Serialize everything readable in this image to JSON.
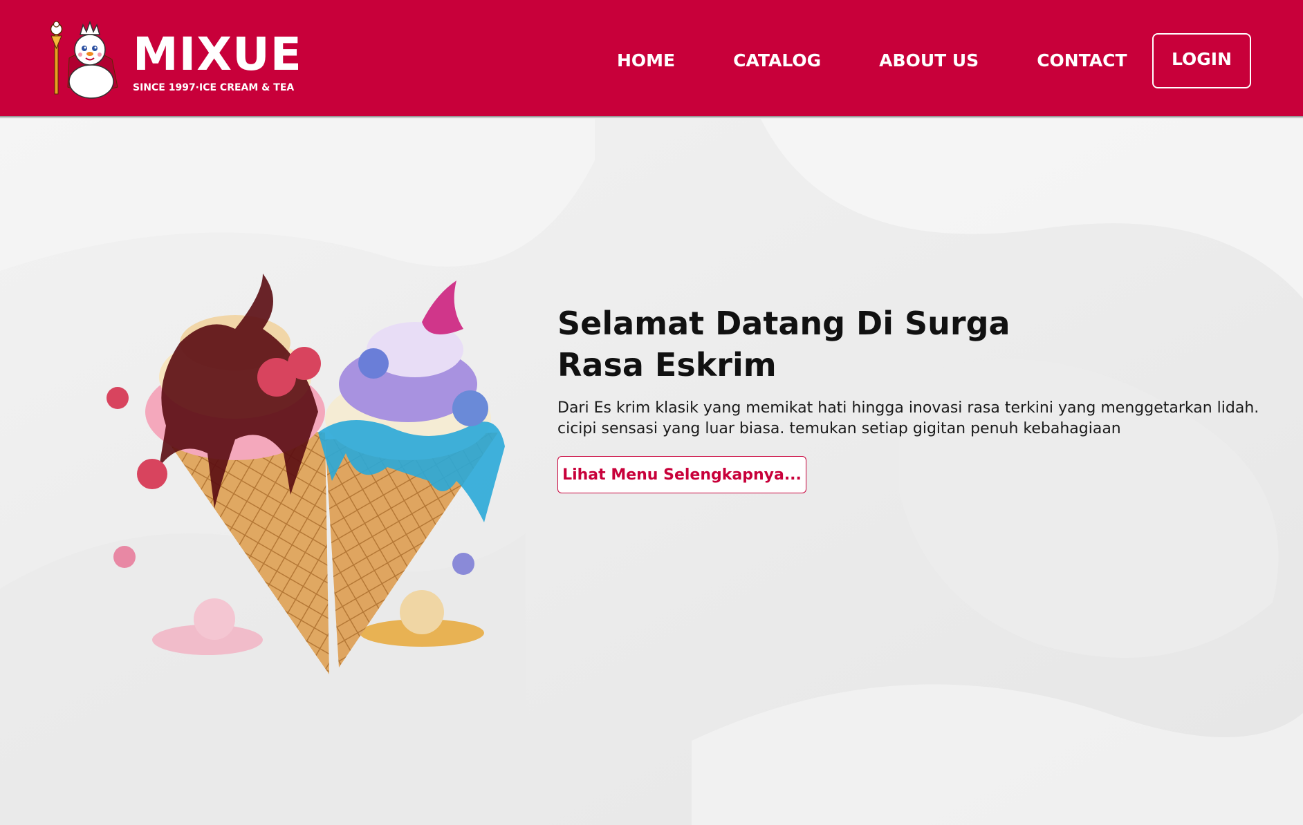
{
  "brand": {
    "name": "MIXUE",
    "tagline": "SINCE 1997·ICE CREAM & TEA",
    "mascot_icon": "snowman-king-mascot-icon"
  },
  "nav": {
    "items": [
      {
        "label": "HOME"
      },
      {
        "label": "CATALOG"
      },
      {
        "label": "ABOUT US"
      },
      {
        "label": "CONTACT"
      }
    ],
    "login_label": "LOGIN"
  },
  "hero": {
    "title": "Selamat Datang Di Surga Rasa Eskrim",
    "description_line1": "Dari Es krim klasik yang memikat hati hingga inovasi rasa terkini yang menggetarkan lidah.",
    "description_line2": "cicipi sensasi yang luar biasa. temukan setiap gigitan  penuh kebahagiaan",
    "cta_label": "Lihat Menu Selengkapnya...",
    "illustration": "ice-cream-cones-icon"
  },
  "colors": {
    "brand_red": "#c8003a",
    "background": "#ededed",
    "white": "#ffffff"
  }
}
